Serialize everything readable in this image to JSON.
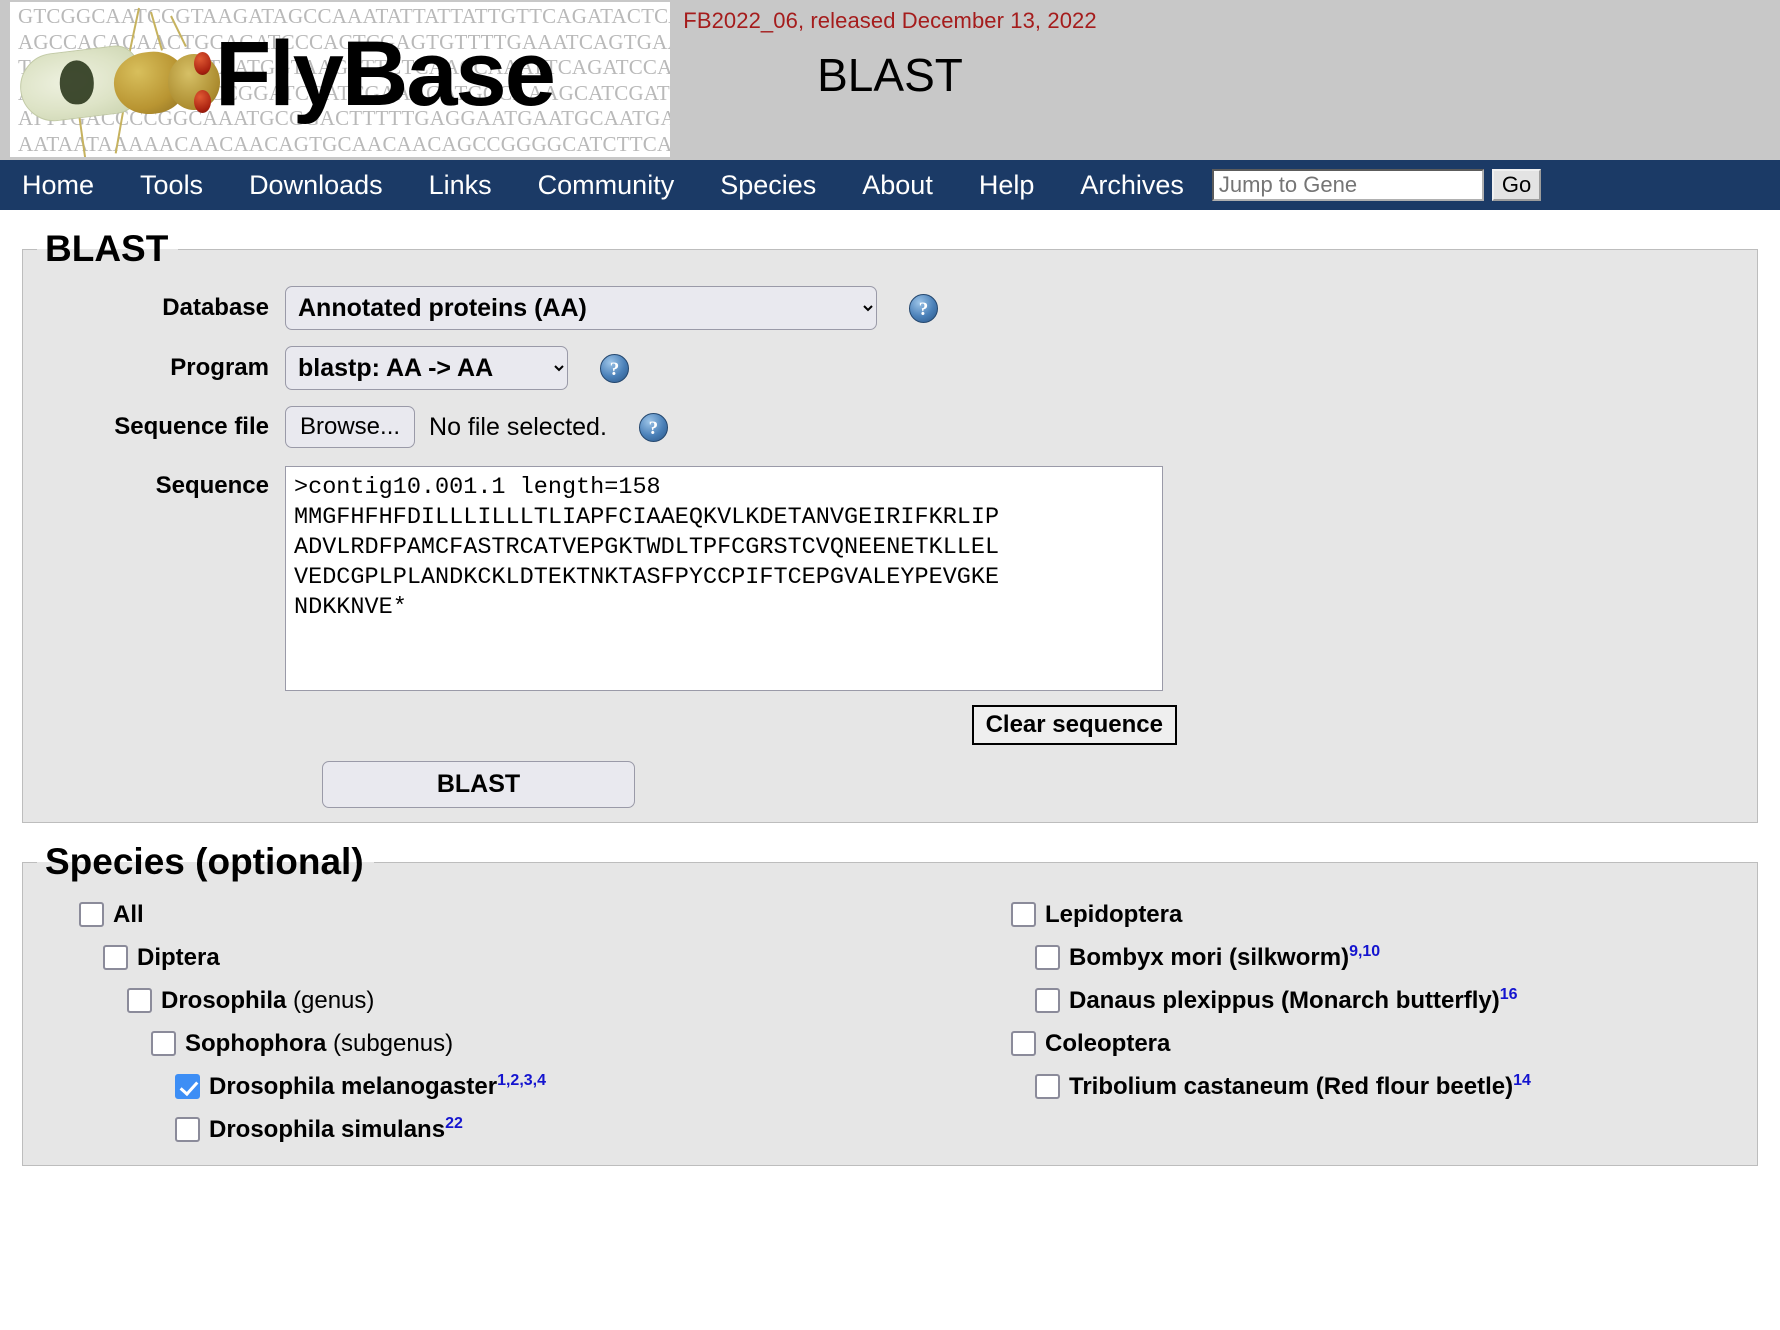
{
  "header": {
    "logo_text": "FlyBase",
    "dna_lines": [
      "GTCGGCAATCCGTAAGATAGCCAAATATTATTATTGTTCAGATACTCAC",
      "AGCCACACAACTGCAGATCCCACTCGAGTGTTTTGAAATCAGTGAAATT",
      "TCAAACGGCAAATTAATGGTAAGTTTCTCAACCAAATTCAGATCCATTT",
      "AACGGCCGGAAATCCGGATCGATCGAAAGATGGCAAAGCATCGATCGAT",
      "ATTTGACCCCGGCAAATGCGGACTTTTTGAGGAATGAATGCAATGAATGA",
      "AATAATAAAAACAACAACAGTGCAACAACAGCCGGGGCATCTTCATAGA"
    ],
    "release": "FB2022_06, released December 13, 2022",
    "page_title": "BLAST"
  },
  "nav": {
    "items": [
      {
        "label": "Home"
      },
      {
        "label": "Tools"
      },
      {
        "label": "Downloads"
      },
      {
        "label": "Links"
      },
      {
        "label": "Community"
      },
      {
        "label": "Species"
      },
      {
        "label": "About"
      },
      {
        "label": "Help"
      },
      {
        "label": "Archives"
      }
    ],
    "jump_placeholder": "Jump to Gene",
    "jump_value": "",
    "go_label": "Go"
  },
  "blast": {
    "legend": "BLAST",
    "database_label": "Database",
    "database_value": "Annotated proteins (AA)",
    "database_options": [
      "Annotated proteins (AA)"
    ],
    "program_label": "Program",
    "program_value": "blastp: AA -> AA",
    "program_options": [
      "blastp: AA -> AA"
    ],
    "sequence_file_label": "Sequence file",
    "browse_label": "Browse...",
    "no_file_text": "No file selected.",
    "sequence_label": "Sequence",
    "sequence_value": ">contig10.001.1 length=158\nMMGFHFHFDILLLILLLTLIAPFCIAAEQKVLKDETANVGEIRIFKRLIP\nADVLRDFPAMCFASTRCATVEPGKTWDLTPFCGRSTCVQNEENETKLLEL\nVEDCGPLPLANDKCKLDTEKTNKTASFPYCCPIFTCEPGVALEYPEVGKE\nNDKKNVE*",
    "clear_label": "Clear sequence",
    "submit_label": "BLAST",
    "help_glyph": "?"
  },
  "species": {
    "legend": "Species (optional)",
    "left_column": [
      {
        "label": "All",
        "bold": "All",
        "normal": "",
        "sup": "",
        "indent": 0,
        "checked": false
      },
      {
        "label": "Diptera",
        "bold": "Diptera",
        "normal": "",
        "sup": "",
        "indent": 1,
        "checked": false
      },
      {
        "label": "Drosophila (genus)",
        "bold": "Drosophila",
        "normal": " (genus)",
        "sup": "",
        "indent": 2,
        "checked": false
      },
      {
        "label": "Sophophora (subgenus)",
        "bold": "Sophophora",
        "normal": " (subgenus)",
        "sup": "",
        "indent": 3,
        "checked": false
      },
      {
        "label": "Drosophila melanogaster",
        "bold": "Drosophila melanogaster",
        "normal": "",
        "sup": "1,2,3,4",
        "indent": 4,
        "checked": true
      },
      {
        "label": "Drosophila simulans",
        "bold": "Drosophila simulans",
        "normal": "",
        "sup": "22",
        "indent": 4,
        "checked": false
      }
    ],
    "right_column": [
      {
        "label": "Lepidoptera",
        "bold": "Lepidoptera",
        "normal": "",
        "sup": "",
        "indent": 1,
        "checked": false
      },
      {
        "label": "Bombyx mori (silkworm)",
        "bold": "Bombyx mori (silkworm)",
        "normal": "",
        "sup": "9,10",
        "indent": 2,
        "checked": false
      },
      {
        "label": "Danaus plexippus (Monarch butterfly)",
        "bold": "Danaus plexippus (Monarch butterfly)",
        "normal": "",
        "sup": "16",
        "indent": 2,
        "checked": false
      },
      {
        "label": "Coleoptera",
        "bold": "Coleoptera",
        "normal": "",
        "sup": "",
        "indent": 1,
        "checked": false
      },
      {
        "label": "Tribolium castaneum (Red flour beetle)",
        "bold": "Tribolium castaneum (Red flour beetle)",
        "normal": "",
        "sup": "14",
        "indent": 2,
        "checked": false
      }
    ]
  },
  "colors": {
    "nav_bg": "#1b3a66",
    "release_text": "#a51c1c",
    "panel_bg": "#e6e6e6",
    "header_bg": "#c8c8c8",
    "checkbox_checked": "#3d8ef5",
    "superscript": "#1414cf"
  }
}
